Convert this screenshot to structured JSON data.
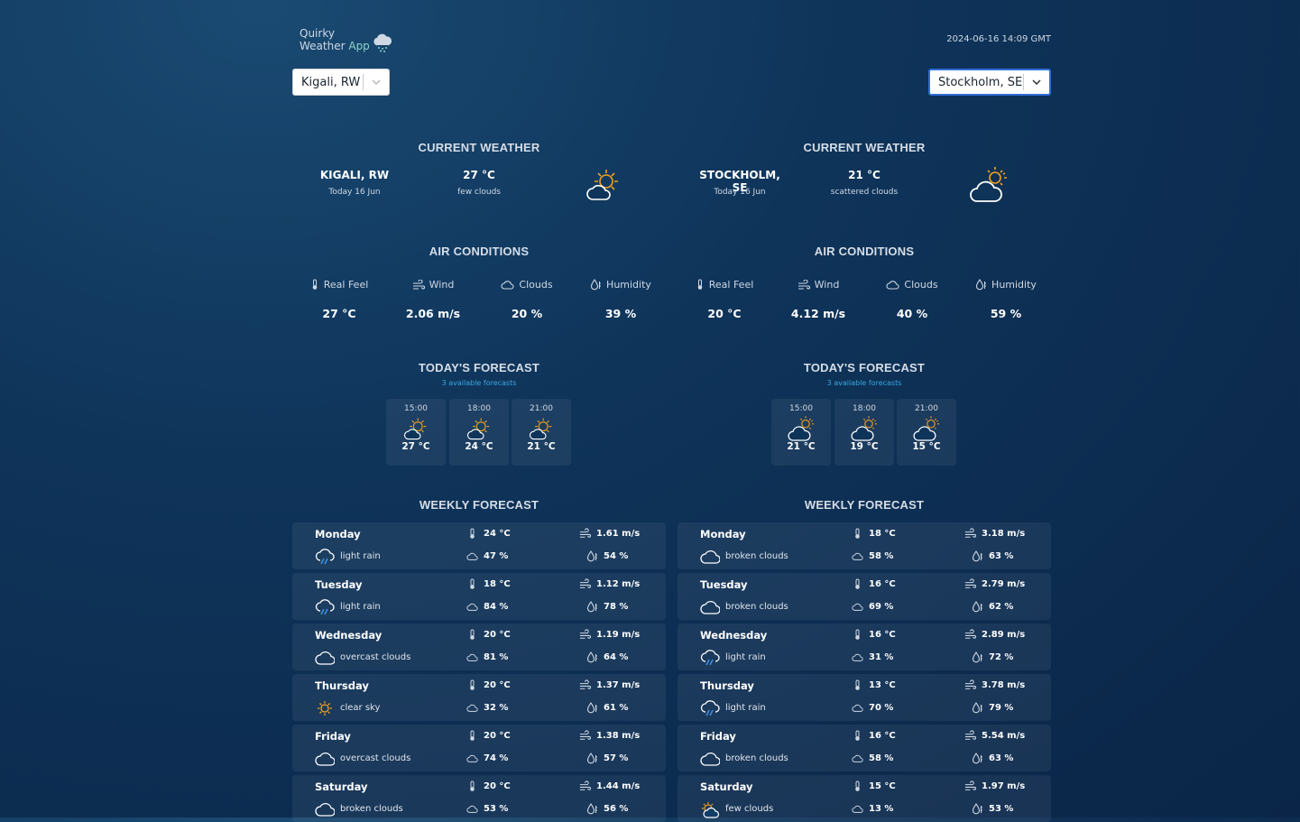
{
  "app": {
    "name_line1": "Quirky",
    "name_line2": "Weather",
    "name_line2_accent": "App",
    "datetime": "2024-06-16 14:09 GMT"
  },
  "colors": {
    "accent": "#3aa8e0",
    "sun": "#f0a020",
    "rain": "#3a8fe0",
    "select_focus": "#2f6fd6"
  },
  "selects": {
    "left": "Kigali, RW",
    "right": "Stockholm, SE"
  },
  "sections": {
    "current": "CURRENT WEATHER",
    "air": "AIR CONDITIONS",
    "today": "TODAY'S FORECAST",
    "weekly": "WEEKLY FORECAST"
  },
  "air_labels": {
    "real_feel": "Real Feel",
    "wind": "Wind",
    "clouds": "Clouds",
    "humidity": "Humidity"
  },
  "left": {
    "current": {
      "city": "KIGALI, RW",
      "date": "Today 16 Jun",
      "temp": "27 °C",
      "desc": "few clouds",
      "icon": "sun-cloud-icon"
    },
    "air": {
      "real_feel": "27 °C",
      "wind": "2.06 m/s",
      "clouds": "20 %",
      "humidity": "39 %"
    },
    "today": {
      "available": "3 available forecasts",
      "items": [
        {
          "time": "15:00",
          "temp": "27 °C",
          "icon": "sun-cloud-icon"
        },
        {
          "time": "18:00",
          "temp": "24 °C",
          "icon": "sun-cloud-icon"
        },
        {
          "time": "21:00",
          "temp": "21 °C",
          "icon": "sun-cloud-icon"
        }
      ]
    },
    "weekly": [
      {
        "day": "Monday",
        "desc": "light rain",
        "icon": "rain-icon",
        "temp": "24 °C",
        "clouds": "47 %",
        "wind": "1.61 m/s",
        "humidity": "54 %"
      },
      {
        "day": "Tuesday",
        "desc": "light rain",
        "icon": "rain-icon",
        "temp": "18 °C",
        "clouds": "84 %",
        "wind": "1.12 m/s",
        "humidity": "78 %"
      },
      {
        "day": "Wednesday",
        "desc": "overcast clouds",
        "icon": "cloud-icon",
        "temp": "20 °C",
        "clouds": "81 %",
        "wind": "1.19 m/s",
        "humidity": "64 %"
      },
      {
        "day": "Thursday",
        "desc": "clear sky",
        "icon": "sun-icon",
        "temp": "20 °C",
        "clouds": "32 %",
        "wind": "1.37 m/s",
        "humidity": "61 %"
      },
      {
        "day": "Friday",
        "desc": "overcast clouds",
        "icon": "cloud-icon",
        "temp": "20 °C",
        "clouds": "74 %",
        "wind": "1.38 m/s",
        "humidity": "57 %"
      },
      {
        "day": "Saturday",
        "desc": "broken clouds",
        "icon": "cloud-icon",
        "temp": "20 °C",
        "clouds": "53 %",
        "wind": "1.44 m/s",
        "humidity": "56 %"
      }
    ]
  },
  "right": {
    "current": {
      "city": "STOCKHOLM, SE",
      "date": "Today 16 Jun",
      "temp": "21 °C",
      "desc": "scattered clouds",
      "icon": "cloud-sun-icon"
    },
    "air": {
      "real_feel": "20 °C",
      "wind": "4.12 m/s",
      "clouds": "40 %",
      "humidity": "59 %"
    },
    "today": {
      "available": "3 available forecasts",
      "items": [
        {
          "time": "15:00",
          "temp": "21 °C",
          "icon": "cloud-sun-icon"
        },
        {
          "time": "18:00",
          "temp": "19 °C",
          "icon": "cloud-sun-icon"
        },
        {
          "time": "21:00",
          "temp": "15 °C",
          "icon": "cloud-sun-icon"
        }
      ]
    },
    "weekly": [
      {
        "day": "Monday",
        "desc": "broken clouds",
        "icon": "cloud-icon",
        "temp": "18 °C",
        "clouds": "58 %",
        "wind": "3.18 m/s",
        "humidity": "63 %"
      },
      {
        "day": "Tuesday",
        "desc": "broken clouds",
        "icon": "cloud-icon",
        "temp": "16 °C",
        "clouds": "69 %",
        "wind": "2.79 m/s",
        "humidity": "62 %"
      },
      {
        "day": "Wednesday",
        "desc": "light rain",
        "icon": "rain-icon",
        "temp": "16 °C",
        "clouds": "31 %",
        "wind": "2.89 m/s",
        "humidity": "72 %"
      },
      {
        "day": "Thursday",
        "desc": "light rain",
        "icon": "rain-icon",
        "temp": "13 °C",
        "clouds": "70 %",
        "wind": "3.78 m/s",
        "humidity": "79 %"
      },
      {
        "day": "Friday",
        "desc": "broken clouds",
        "icon": "cloud-icon",
        "temp": "16 °C",
        "clouds": "58 %",
        "wind": "5.54 m/s",
        "humidity": "63 %"
      },
      {
        "day": "Saturday",
        "desc": "few clouds",
        "icon": "sun-cloud-icon",
        "temp": "15 °C",
        "clouds": "13 %",
        "wind": "1.97 m/s",
        "humidity": "53 %"
      }
    ]
  }
}
